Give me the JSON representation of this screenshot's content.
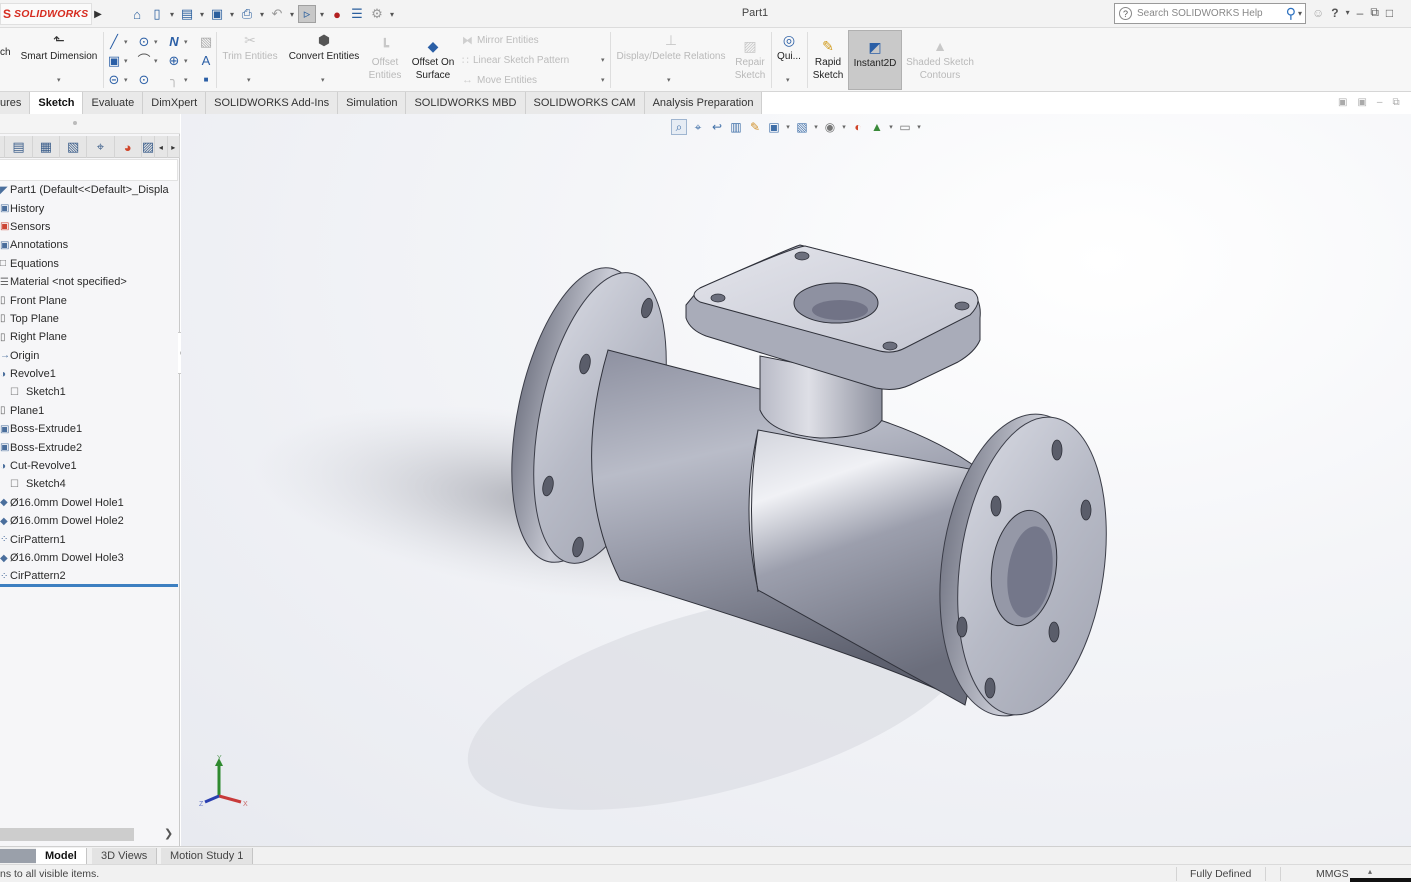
{
  "app": {
    "logo_ds": "ʟ",
    "logo_text": "SOLIDWORKS",
    "document_title": "Part1"
  },
  "quick_access": [
    {
      "icon": "home-icon",
      "glyph": "⌂"
    },
    {
      "icon": "new-document-icon",
      "glyph": "▯",
      "dropdown": true
    },
    {
      "icon": "open-folder-icon",
      "glyph": "▤",
      "dropdown": true
    },
    {
      "icon": "save-icon",
      "glyph": "▣",
      "dropdown": true
    },
    {
      "icon": "print-icon",
      "glyph": "⎙",
      "dropdown": true
    },
    {
      "icon": "undo-icon",
      "glyph": "↶",
      "dropdown": true
    },
    {
      "icon": "select-cursor-icon",
      "glyph": "▹",
      "dropdown": true,
      "selected": true
    },
    {
      "icon": "rebuild-traffic-light-icon",
      "glyph": "●"
    },
    {
      "icon": "file-properties-icon",
      "glyph": "☰"
    },
    {
      "icon": "options-gear-icon",
      "glyph": "⚙",
      "dropdown": true
    }
  ],
  "search": {
    "placeholder": "Search SOLIDWORKS Help"
  },
  "title_controls": {
    "user": "☺",
    "help": "?",
    "help_dd": "▾",
    "minimize": "–",
    "restore": "⧉",
    "maximize": "□"
  },
  "ribbon": {
    "sketch_partial": "ch",
    "smart_dimension": "Smart Dimension",
    "trim_entities": "Trim Entities",
    "convert_entities": "Convert Entities",
    "offset_entities_1": "Offset",
    "offset_entities_2": "Entities",
    "offset_on_surface_1": "Offset On",
    "offset_on_surface_2": "Surface",
    "mirror_entities": "Mirror Entities",
    "linear_sketch_pattern": "Linear Sketch Pattern",
    "move_entities": "Move Entities",
    "display_delete_relations": "Display/Delete Relations",
    "repair_sketch_1": "Repair",
    "repair_sketch_2": "Sketch",
    "quick_snaps": "Qui...",
    "rapid_sketch_1": "Rapid",
    "rapid_sketch_2": "Sketch",
    "instant2d": "Instant2D",
    "shaded_contours_1": "Shaded Sketch",
    "shaded_contours_2": "Contours"
  },
  "command_tabs": [
    {
      "label": "ures",
      "active": false
    },
    {
      "label": "Sketch",
      "active": true
    },
    {
      "label": "Evaluate",
      "active": false
    },
    {
      "label": "DimXpert",
      "active": false
    },
    {
      "label": "SOLIDWORKS Add-Ins",
      "active": false
    },
    {
      "label": "Simulation",
      "active": false
    },
    {
      "label": "SOLIDWORKS MBD",
      "active": false
    },
    {
      "label": "SOLIDWORKS CAM",
      "active": false
    },
    {
      "label": "Analysis Preparation",
      "active": false
    }
  ],
  "feature_tree": [
    {
      "label": "Part1  (Default<<Default>_Displa",
      "icon": "part-icon",
      "child": false
    },
    {
      "label": "History",
      "icon": "history-icon",
      "child": false
    },
    {
      "label": "Sensors",
      "icon": "sensors-icon",
      "child": false
    },
    {
      "label": "Annotations",
      "icon": "annotations-icon",
      "child": false
    },
    {
      "label": "Equations",
      "icon": "equations-icon",
      "child": false
    },
    {
      "label": "Material <not specified>",
      "icon": "material-icon",
      "child": false
    },
    {
      "label": "Front Plane",
      "icon": "plane-icon",
      "child": false
    },
    {
      "label": "Top Plane",
      "icon": "plane-icon",
      "child": false
    },
    {
      "label": "Right Plane",
      "icon": "plane-icon",
      "child": false
    },
    {
      "label": "Origin",
      "icon": "origin-icon",
      "child": false
    },
    {
      "label": "Revolve1",
      "icon": "revolve-icon",
      "child": false
    },
    {
      "label": "Sketch1",
      "icon": "sketch-icon",
      "child": true
    },
    {
      "label": "Plane1",
      "icon": "plane-icon",
      "child": false
    },
    {
      "label": "Boss-Extrude1",
      "icon": "extrude-icon",
      "child": false
    },
    {
      "label": "Boss-Extrude2",
      "icon": "extrude-icon",
      "child": false
    },
    {
      "label": "Cut-Revolve1",
      "icon": "cut-revolve-icon",
      "child": false
    },
    {
      "label": "Sketch4",
      "icon": "sketch-icon",
      "child": true
    },
    {
      "label": "Ø16.0mm Dowel Hole1",
      "icon": "hole-wizard-icon",
      "child": false
    },
    {
      "label": "Ø16.0mm Dowel Hole2",
      "icon": "hole-wizard-icon",
      "child": false
    },
    {
      "label": "CirPattern1",
      "icon": "circular-pattern-icon",
      "child": false
    },
    {
      "label": "Ø16.0mm Dowel Hole3",
      "icon": "hole-wizard-icon",
      "child": false
    },
    {
      "label": "CirPattern2",
      "icon": "circular-pattern-icon",
      "child": false
    }
  ],
  "fm_tabs": [
    {
      "icon": "feature-manager-tab-icon",
      "glyph": "▤"
    },
    {
      "icon": "property-manager-tab-icon",
      "glyph": "▦"
    },
    {
      "icon": "configuration-manager-tab-icon",
      "glyph": "▧"
    },
    {
      "icon": "dimxpert-manager-tab-icon",
      "glyph": "⌖"
    },
    {
      "icon": "display-manager-tab-icon",
      "glyph": "◕"
    },
    {
      "icon": "cam-tab-icon",
      "glyph": "▨"
    }
  ],
  "heads_up_toolbar": [
    {
      "icon": "zoom-to-fit-icon",
      "glyph": "⌕",
      "selected": true
    },
    {
      "icon": "zoom-to-area-icon",
      "glyph": "⌖"
    },
    {
      "icon": "previous-view-icon",
      "glyph": "↩"
    },
    {
      "icon": "section-view-icon",
      "glyph": "▥"
    },
    {
      "icon": "dynamic-annotation-icon",
      "glyph": "✎"
    },
    {
      "icon": "view-orientation-icon",
      "glyph": "▣",
      "dropdown": true
    },
    {
      "icon": "display-style-icon",
      "glyph": "▧",
      "dropdown": true
    },
    {
      "icon": "hide-show-items-icon",
      "glyph": "◉",
      "dropdown": true
    },
    {
      "icon": "edit-appearance-icon",
      "glyph": "◐"
    },
    {
      "icon": "apply-scene-icon",
      "glyph": "▲",
      "dropdown": true
    },
    {
      "icon": "view-settings-icon",
      "glyph": "▭",
      "dropdown": true
    }
  ],
  "triad": {
    "x": "X",
    "y": "Y",
    "z": "Z"
  },
  "bottom_tabs": [
    {
      "label": "Model",
      "active": true
    },
    {
      "label": "3D Views",
      "active": false
    },
    {
      "label": "Motion Study 1",
      "active": false
    }
  ],
  "status": {
    "message": "ns to all visible items.",
    "sketch_state": "Fully Defined",
    "units": "MMGS",
    "units_dropdown": "▴"
  },
  "colors": {
    "brand_red": "#d62b1f",
    "accent_blue": "#2b5fa6",
    "rollback_bar": "#3d7fc1"
  }
}
